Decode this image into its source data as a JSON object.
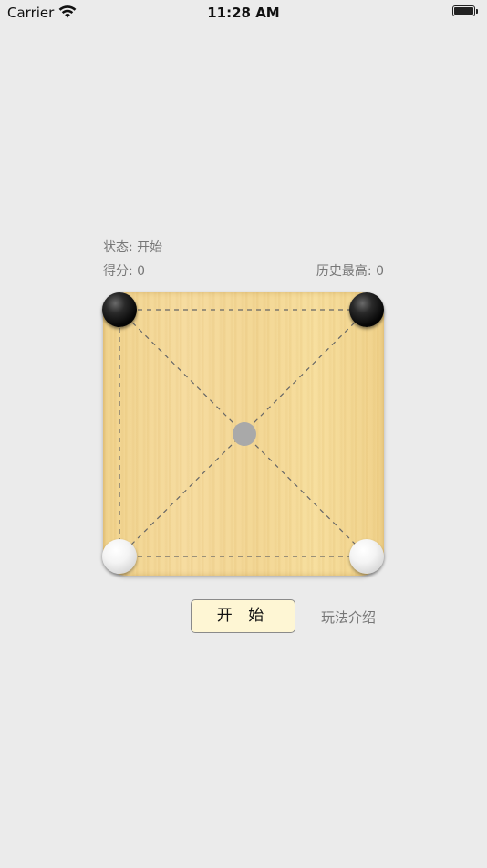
{
  "status_bar": {
    "carrier": "Carrier",
    "time": "11:28 AM",
    "wifi_icon": "wifi-icon",
    "battery_icon": "battery-icon",
    "battery_level": 1.0
  },
  "game": {
    "status_label": "状态: 开始",
    "score_label": "得分: 0",
    "best_label": "历史最高: 0",
    "board": {
      "pieces": [
        {
          "color": "black",
          "position": "top-left"
        },
        {
          "color": "black",
          "position": "top-right"
        },
        {
          "color": "white",
          "position": "bottom-left"
        },
        {
          "color": "white",
          "position": "bottom-right"
        }
      ],
      "empty_point": "center",
      "colors": {
        "black": "#050505",
        "white": "#f4f4f4",
        "empty": "#a9a9a9",
        "board": "#f3d795"
      }
    }
  },
  "controls": {
    "start_label": "开 始",
    "rules_label": "玩法介绍"
  }
}
